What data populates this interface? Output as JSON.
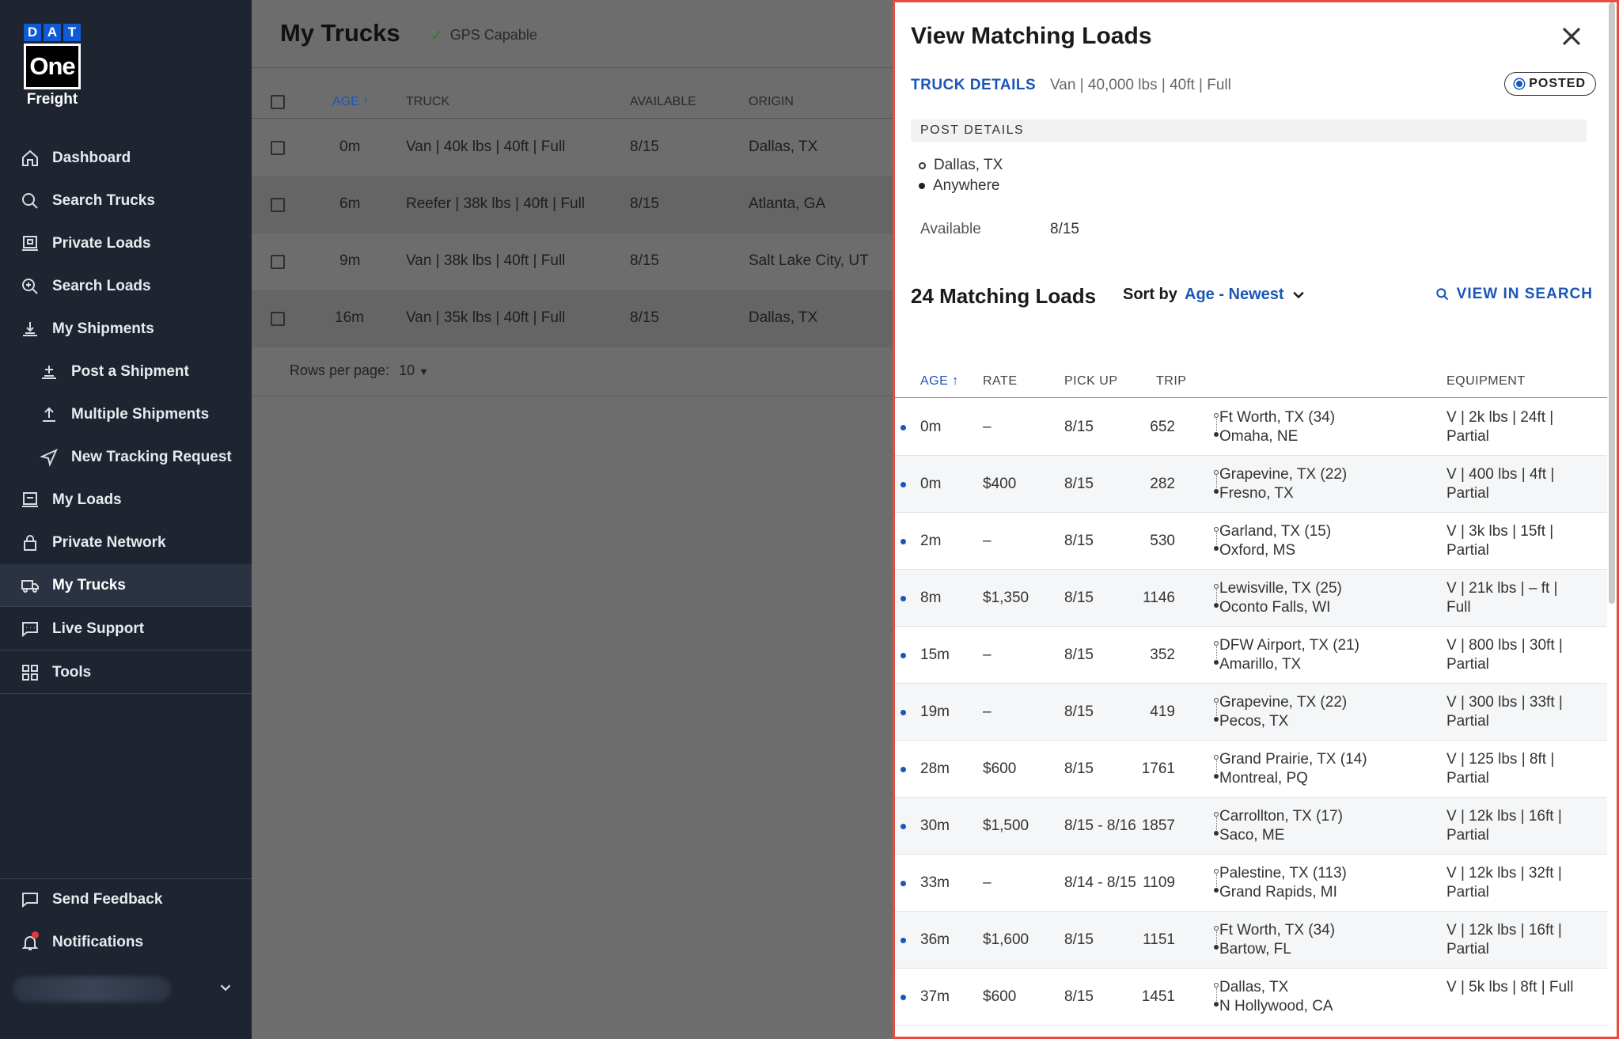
{
  "logo": {
    "letters": [
      "D",
      "A",
      "T"
    ],
    "one": "One",
    "freight": "Freight"
  },
  "nav": {
    "items": [
      {
        "label": "Dashboard"
      },
      {
        "label": "Search Trucks"
      },
      {
        "label": "Private Loads"
      },
      {
        "label": "Search Loads"
      },
      {
        "label": "My Shipments"
      },
      {
        "label": "Post a Shipment"
      },
      {
        "label": "Multiple Shipments"
      },
      {
        "label": "New Tracking Request"
      },
      {
        "label": "My Loads"
      },
      {
        "label": "Private Network"
      },
      {
        "label": "My Trucks"
      },
      {
        "label": "Live Support"
      },
      {
        "label": "Tools"
      }
    ],
    "feedback": "Send Feedback",
    "notifications": "Notifications"
  },
  "main": {
    "title": "My Trucks",
    "gps": "GPS Capable",
    "columns": {
      "age": "AGE",
      "truck": "TRUCK",
      "available": "AVAILABLE",
      "origin": "ORIGIN"
    },
    "rows": [
      {
        "age": "0m",
        "truck": "Van | 40k lbs | 40ft | Full",
        "available": "8/15",
        "origin": "Dallas, TX"
      },
      {
        "age": "6m",
        "truck": "Reefer | 38k lbs | 40ft | Full",
        "available": "8/15",
        "origin": "Atlanta, GA"
      },
      {
        "age": "9m",
        "truck": "Van | 38k lbs | 40ft | Full",
        "available": "8/15",
        "origin": "Salt Lake City, UT"
      },
      {
        "age": "16m",
        "truck": "Van | 35k lbs | 40ft | Full",
        "available": "8/15",
        "origin": "Dallas, TX"
      }
    ],
    "rows_per_page_label": "Rows per page:",
    "rows_per_page_value": "10"
  },
  "panel": {
    "title": "View Matching Loads",
    "truck_details_label": "TRUCK DETAILS",
    "truck_details_value": "Van | 40,000 lbs | 40ft | Full",
    "posted": "POSTED",
    "post_details": "POST DETAILS",
    "origin": "Dallas, TX",
    "destination": "Anywhere",
    "available_label": "Available",
    "available_value": "8/15",
    "matching_title": "24 Matching Loads",
    "sort_label": "Sort by",
    "sort_value": "Age - Newest",
    "view_in_search": "VIEW IN SEARCH",
    "columns": {
      "age": "AGE",
      "rate": "RATE",
      "pickup": "PICK UP",
      "trip": "TRIP",
      "equipment": "EQUIPMENT"
    },
    "loads": [
      {
        "age": "0m",
        "rate": "–",
        "pickup": "8/15",
        "trip": "652",
        "origin": "Ft Worth, TX (34)",
        "dest": "Omaha, NE",
        "eq1": "V | 2k lbs | 24ft |",
        "eq2": "Partial"
      },
      {
        "age": "0m",
        "rate": "$400",
        "pickup": "8/15",
        "trip": "282",
        "origin": "Grapevine, TX (22)",
        "dest": "Fresno, TX",
        "eq1": "V | 400 lbs | 4ft |",
        "eq2": "Partial"
      },
      {
        "age": "2m",
        "rate": "–",
        "pickup": "8/15",
        "trip": "530",
        "origin": "Garland, TX (15)",
        "dest": "Oxford, MS",
        "eq1": "V | 3k lbs | 15ft |",
        "eq2": "Partial"
      },
      {
        "age": "8m",
        "rate": "$1,350",
        "pickup": "8/15",
        "trip": "1146",
        "origin": "Lewisville, TX (25)",
        "dest": "Oconto Falls, WI",
        "eq1": "V | 21k lbs | – ft |",
        "eq2": "Full"
      },
      {
        "age": "15m",
        "rate": "–",
        "pickup": "8/15",
        "trip": "352",
        "origin": "DFW Airport, TX (21)",
        "dest": "Amarillo, TX",
        "eq1": "V | 800 lbs | 30ft |",
        "eq2": "Partial"
      },
      {
        "age": "19m",
        "rate": "–",
        "pickup": "8/15",
        "trip": "419",
        "origin": "Grapevine, TX (22)",
        "dest": "Pecos, TX",
        "eq1": "V | 300 lbs | 33ft |",
        "eq2": "Partial"
      },
      {
        "age": "28m",
        "rate": "$600",
        "pickup": "8/15",
        "trip": "1761",
        "origin": "Grand Prairie, TX (14)",
        "dest": "Montreal, PQ",
        "eq1": "V | 125 lbs | 8ft |",
        "eq2": "Partial"
      },
      {
        "age": "30m",
        "rate": "$1,500",
        "pickup": "8/15 - 8/16",
        "trip": "1857",
        "origin": "Carrollton, TX (17)",
        "dest": "Saco, ME",
        "eq1": "V | 12k lbs | 16ft |",
        "eq2": "Partial"
      },
      {
        "age": "33m",
        "rate": "–",
        "pickup": "8/14 - 8/15",
        "trip": "1109",
        "origin": "Palestine, TX (113)",
        "dest": "Grand Rapids, MI",
        "eq1": "V | 12k lbs | 32ft |",
        "eq2": "Partial"
      },
      {
        "age": "36m",
        "rate": "$1,600",
        "pickup": "8/15",
        "trip": "1151",
        "origin": "Ft Worth, TX (34)",
        "dest": "Bartow, FL",
        "eq1": "V | 12k lbs | 16ft |",
        "eq2": "Partial"
      },
      {
        "age": "37m",
        "rate": "$600",
        "pickup": "8/15",
        "trip": "1451",
        "origin": "Dallas, TX",
        "dest": "N Hollywood, CA",
        "eq1": "V | 5k lbs | 8ft | Full",
        "eq2": ""
      }
    ]
  },
  "colors": {
    "sidebar": "#1e2430",
    "accent": "#1a56b8",
    "panel_border": "#e74c3c"
  }
}
